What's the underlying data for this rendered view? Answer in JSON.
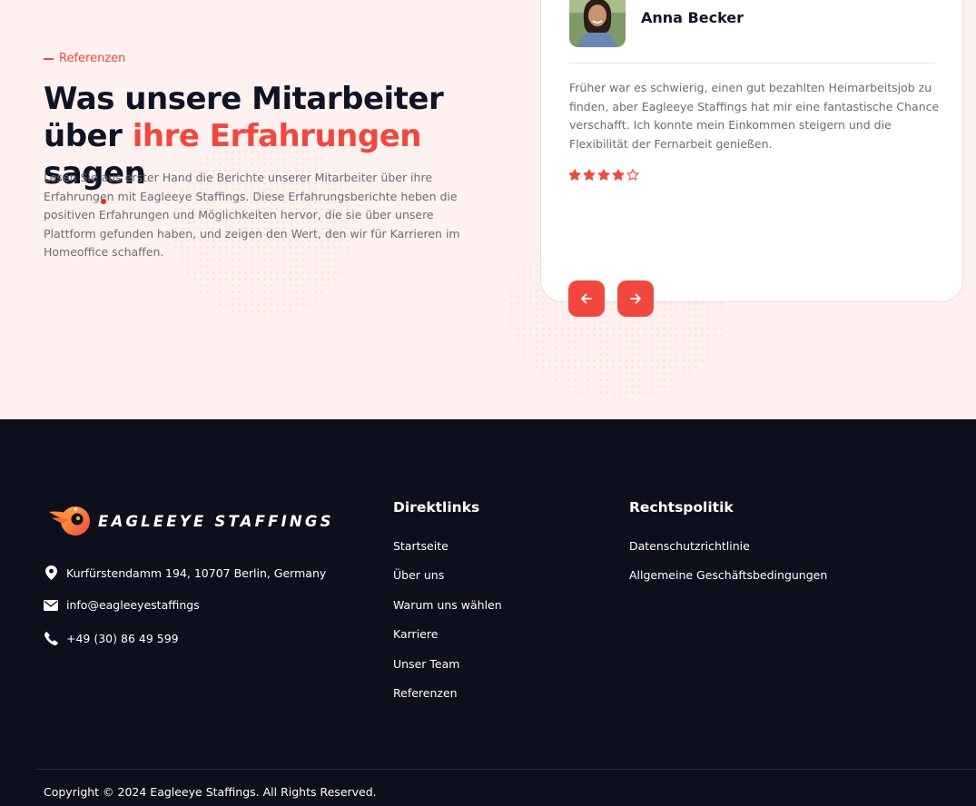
{
  "testimonials": {
    "eyebrow": "Referenzen",
    "heading_line1": "Was unsere Mitarbeiter",
    "heading_line2_prefix": "über ",
    "heading_line2_accent": "ihre Erfahrungen",
    "heading_line2_suffix": " sagen",
    "description": "Lesen Sie aus erster Hand die Berichte unserer Mitarbeiter über ihre Erfahrungen mit Eagleeye Staffings. Diese Erfahrungsberichte heben die positiven Erfahrungen und Möglichkeiten hervor, die sie über unsere Plattform gefunden haben, und zeigen den Wert, den wir für Karrieren im Homeoffice schaffen.",
    "card": {
      "name": "Anna Becker",
      "quote": "Früher war es schwierig, einen gut bezahlten Heimarbeitsjob zu finden, aber Eagleeye Staffings hat mir eine fantastische Chance verschafft. Ich konnte mein Einkommen steigern und die Flexibilität der Fernarbeit genießen.",
      "rating": 4,
      "rating_max": 5
    },
    "prev_icon": "arrow-left-icon",
    "next_icon": "arrow-right-icon"
  },
  "footer": {
    "logo_text": "EAGLEEYE STAFFINGS",
    "address": "Kurfürstendamm 194, 10707 Berlin, Germany",
    "email": "info@eagleeyestaffings",
    "phone": "+49 (30) 86 49 599",
    "quicklinks_title": "Direktlinks",
    "quicklinks": [
      "Startseite",
      "Über uns",
      "Warum uns wählen",
      "Karriere",
      "Unser Team",
      "Referenzen"
    ],
    "legal_title": "Rechtspolitik",
    "legal_links": [
      "Datenschutzrichtlinie",
      "Allgemeine Geschäftsbedingungen"
    ],
    "copyright": "Copyright © 2024 Eagleeye Staffings. All Rights Reserved."
  },
  "colors": {
    "accent": "#f0483e",
    "section_bg": "#fff1ef",
    "footer_bg": "#0e0f1d",
    "heading": "#101226",
    "body_text": "#6b6b76"
  }
}
